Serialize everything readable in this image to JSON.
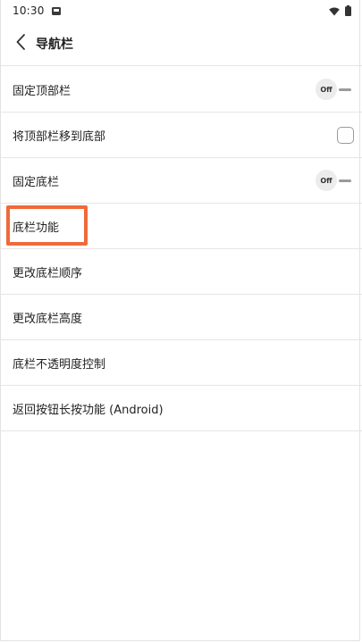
{
  "status_bar": {
    "time": "10:30",
    "icons": [
      "notification-icon",
      "wifi-icon",
      "battery-icon"
    ]
  },
  "header": {
    "back_icon": "chevron-left-icon",
    "title": "导航栏"
  },
  "settings": [
    {
      "label": "固定顶部栏",
      "control": "toggle",
      "state": "Off"
    },
    {
      "label": "将顶部栏移到底部",
      "control": "checkbox",
      "checked": false
    },
    {
      "label": "固定底栏",
      "control": "toggle",
      "state": "Off"
    },
    {
      "label": "底栏功能",
      "control": "none",
      "highlighted": true
    },
    {
      "label": "更改底栏顺序",
      "control": "none"
    },
    {
      "label": "更改底栏高度",
      "control": "none"
    },
    {
      "label": "底栏不透明度控制",
      "control": "none"
    },
    {
      "label": "返回按钮长按功能 (Android)",
      "control": "none"
    }
  ],
  "colors": {
    "highlight": "#ee6a3a",
    "divider": "#e6e6e6",
    "background": "#ffffff"
  }
}
